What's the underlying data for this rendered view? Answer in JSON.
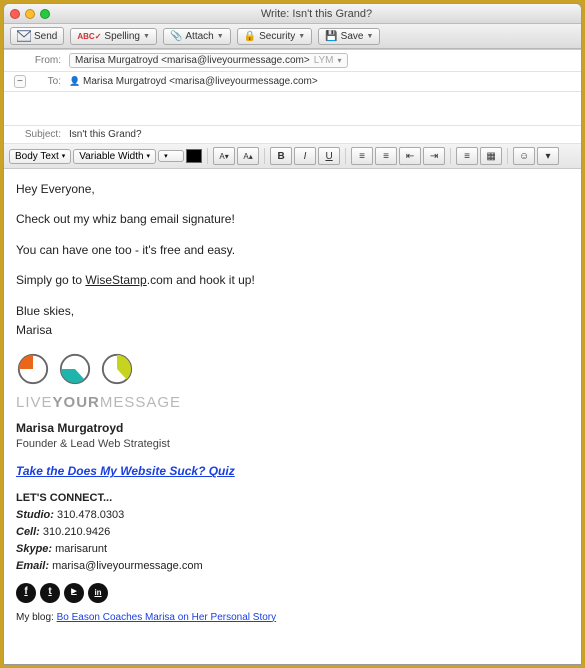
{
  "window": {
    "title": "Write: Isn't this Grand?"
  },
  "toolbar": {
    "send": "Send",
    "spelling": "Spelling",
    "attach": "Attach",
    "security": "Security",
    "save": "Save"
  },
  "headers": {
    "from_label": "From:",
    "from_value": "Marisa Murgatroyd <marisa@liveyourmessage.com>",
    "from_account": "LYM",
    "to_label": "To:",
    "to_value": "Marisa Murgatroyd <marisa@liveyourmessage.com>",
    "subject_label": "Subject:",
    "subject_value": "Isn't this Grand?"
  },
  "format": {
    "style": "Body Text",
    "font": "Variable Width"
  },
  "body": {
    "p1": "Hey Everyone,",
    "p2": "Check out my whiz bang email signature!",
    "p3": "You can have one too - it's free and easy.",
    "p4a": "Simply go to ",
    "p4link": "WiseStamp",
    "p4b": ".com and hook it up!",
    "p5": "Blue skies,",
    "p6": "Marisa"
  },
  "signature": {
    "brand_pre": "LIVE",
    "brand_bold": "YOUR",
    "brand_post": "MESSAGE",
    "name": "Marisa Murgatroyd",
    "role": "Founder & Lead Web Strategist",
    "quiz_link": "Take the Does My Website Suck? Quiz",
    "connect_header": "LET'S CONNECT...",
    "studio_label": "Studio:",
    "studio": "310.478.0303",
    "cell_label": "Cell:",
    "cell": "310.210.9426",
    "skype_label": "Skype:",
    "skype": "marisarunt",
    "email_label": "Email:",
    "email": "marisa@liveyourmessage.com",
    "blog_label": "My blog:",
    "blog_link": "Bo Eason Coaches Marisa on Her Personal Story"
  },
  "icons": {
    "facebook": "f",
    "twitter": "t",
    "youtube": "▶",
    "linkedin": "in"
  }
}
